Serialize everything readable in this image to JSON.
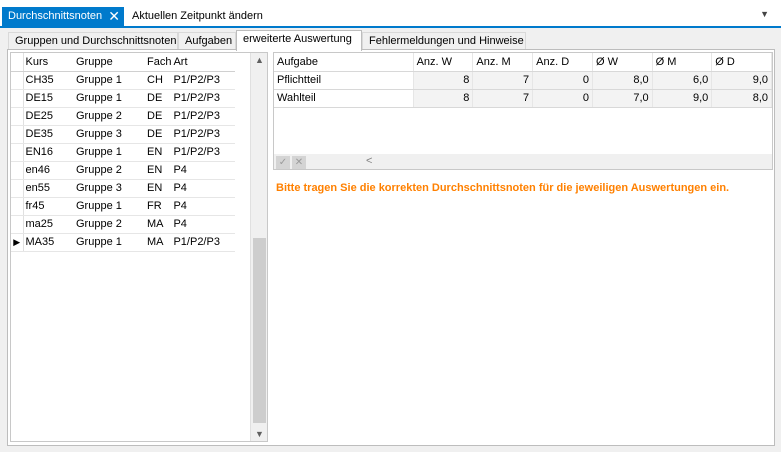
{
  "doc_tabs": {
    "active_label": "Durchschnittsnoten",
    "close_glyph": "✕",
    "inactive_label": "Aktuellen Zeitpunkt ändern",
    "dropdown_glyph": "▼"
  },
  "sub_tabs": [
    {
      "label": "Gruppen und Durchschnittsnoten"
    },
    {
      "label": "Aufgaben"
    },
    {
      "label": "erweiterte Auswertung"
    },
    {
      "label": "Fehlermeldungen und Hinweise"
    }
  ],
  "course_grid": {
    "columns": [
      "Kurs",
      "Gruppe",
      "Fach",
      "Art"
    ],
    "current_row_indicator": "▶",
    "rows": [
      {
        "kurs": "CH35",
        "gruppe": "Gruppe 1",
        "fach": "CH",
        "art": "P1/P2/P3"
      },
      {
        "kurs": "DE15",
        "gruppe": "Gruppe 1",
        "fach": "DE",
        "art": "P1/P2/P3"
      },
      {
        "kurs": "DE25",
        "gruppe": "Gruppe 2",
        "fach": "DE",
        "art": "P1/P2/P3"
      },
      {
        "kurs": "DE35",
        "gruppe": "Gruppe 3",
        "fach": "DE",
        "art": "P1/P2/P3"
      },
      {
        "kurs": "EN16",
        "gruppe": "Gruppe 1",
        "fach": "EN",
        "art": "P1/P2/P3"
      },
      {
        "kurs": "en46",
        "gruppe": "Gruppe 2",
        "fach": "EN",
        "art": "P4"
      },
      {
        "kurs": "en55",
        "gruppe": "Gruppe 3",
        "fach": "EN",
        "art": "P4"
      },
      {
        "kurs": "fr45",
        "gruppe": "Gruppe 1",
        "fach": "FR",
        "art": "P4"
      },
      {
        "kurs": "ma25",
        "gruppe": "Gruppe 2",
        "fach": "MA",
        "art": "P4"
      },
      {
        "kurs": "MA35",
        "gruppe": "Gruppe 1",
        "fach": "MA",
        "art": "P1/P2/P3"
      }
    ],
    "scroll_up_glyph": "▲",
    "scroll_down_glyph": "▼"
  },
  "evaluation_grid": {
    "columns": [
      "Aufgabe",
      "Anz. W",
      "Anz. M",
      "Anz. D",
      "Ø W",
      "Ø M",
      "Ø D"
    ],
    "rows": [
      {
        "aufgabe": "Pflichtteil",
        "anz_w": "8",
        "anz_m": "7",
        "anz_d": "0",
        "avg_w": "8,0",
        "avg_m": "6,0",
        "avg_d": "9,0"
      },
      {
        "aufgabe": "Wahlteil",
        "anz_w": "8",
        "anz_m": "7",
        "anz_d": "0",
        "avg_w": "7,0",
        "avg_m": "9,0",
        "avg_d": "8,0"
      }
    ],
    "confirm_glyph": "✓",
    "cancel_glyph": "✕",
    "scroll_left_glyph": "<"
  },
  "hint_text": "Bitte tragen Sie die korrekten Durchschnittsnoten für die jeweiligen Auswertungen ein.",
  "colors": {
    "accent": "#007acc",
    "hint": "#ff8000"
  }
}
